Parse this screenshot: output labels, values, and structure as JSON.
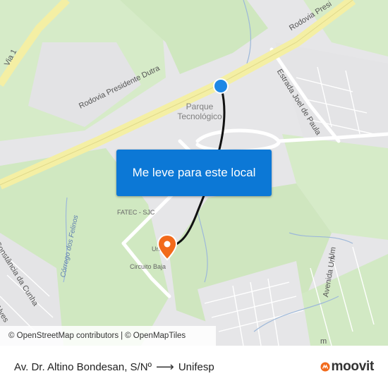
{
  "map": {
    "colors": {
      "background": "#e6e6e8",
      "green": "#d2e9c4",
      "highway": "#f4efa4",
      "route": "#111111",
      "origin": "#1e88e5",
      "destination": "#f26a1b",
      "water": "#9db8d9"
    },
    "labels": {
      "rodovia_dutra": "Rodovia Presidente Dutra",
      "rodovia_presi": "Rodovia Presi",
      "via_1": "Via 1",
      "estrada_joel": "Estrada Joel de Paula",
      "parque_line1": "Parque",
      "parque_line2": "Tecnológico",
      "fatec": "FATEC - SJC",
      "circuito_baja": "Circuito Baja",
      "unifesp_short": "Uni",
      "corrego": "Córrego dos Felinos",
      "constancia": "Constância da Cunha",
      "alves": "Alves",
      "avenida_um": "Avenida Um",
      "avenida_um_short": "Um",
      "bottom_m": "m"
    },
    "origin_icon": "origin-dot-icon",
    "destination_icon": "destination-pin-icon"
  },
  "cta": {
    "label": "Me leve para este local"
  },
  "attribution": {
    "osm_contributors": "© OpenStreetMap contributors",
    "separator": "|",
    "openmaptiles": "© OpenMapTiles"
  },
  "footer": {
    "origin": "Av. Dr. Altino Bondesan, S/Nº",
    "destination": "Unifesp",
    "arrow_icon": "arrow-right-icon",
    "brand": "moovit"
  }
}
